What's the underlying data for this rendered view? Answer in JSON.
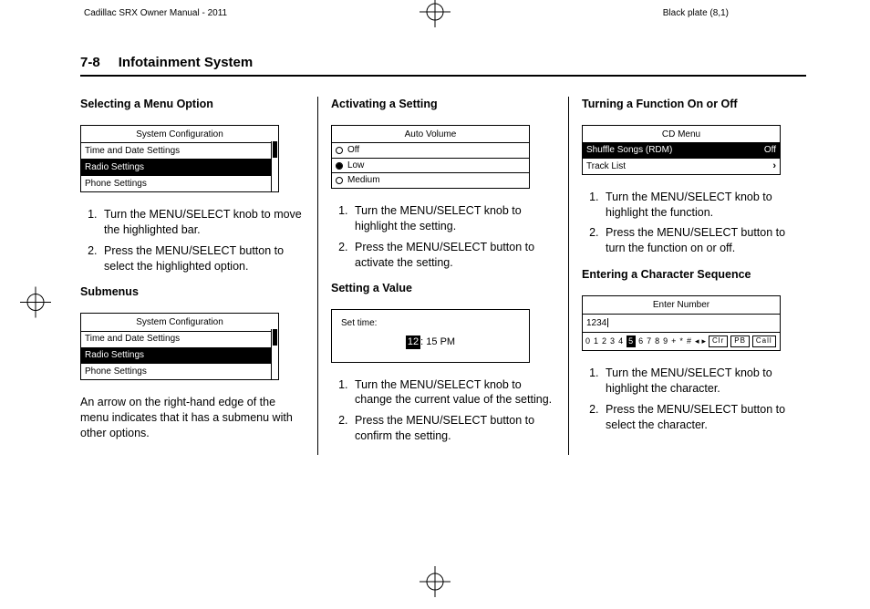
{
  "meta": {
    "doc_title": "Cadillac SRX Owner Manual - 2011",
    "plate": "Black plate (8,1)"
  },
  "header": {
    "page_ref": "7-8",
    "chapter": "Infotainment System"
  },
  "col1": {
    "h1": "Selecting a Menu Option",
    "fig1": {
      "title": "System Configuration",
      "rows": [
        "Time and Date Settings",
        "Radio Settings",
        "Phone Settings"
      ],
      "highlight_index": 1
    },
    "steps1": [
      "Turn the MENU/SELECT knob to move the highlighted bar.",
      "Press the MENU/SELECT button to select the highlighted option."
    ],
    "h2": "Submenus",
    "fig2": {
      "title": "System Configuration",
      "rows": [
        "Time and Date Settings",
        "Radio Settings",
        "Phone Settings"
      ],
      "highlight_index": 1
    },
    "p1": "An arrow on the right-hand edge of the menu indicates that it has a submenu with other options."
  },
  "col2": {
    "h1": "Activating a Setting",
    "fig1": {
      "title": "Auto Volume",
      "options": [
        "Off",
        "Low",
        "Medium"
      ],
      "selected_index": 1
    },
    "steps1": [
      "Turn the MENU/SELECT knob to highlight the setting.",
      "Press the MENU/SELECT button to activate the setting."
    ],
    "h2": "Setting a Value",
    "fig2": {
      "label": "Set time:",
      "hour": "12",
      "rest": ": 15 PM"
    },
    "steps2": [
      "Turn the MENU/SELECT knob to change the current value of the setting.",
      "Press the MENU/SELECT button to confirm the setting."
    ]
  },
  "col3": {
    "h1": "Turning a Function On or Off",
    "fig1": {
      "title": "CD Menu",
      "row1_label": "Shuffle Songs (RDM)",
      "row1_value": "Off",
      "row2_label": "Track List"
    },
    "steps1": [
      "Turn the MENU/SELECT knob to highlight the function.",
      "Press the MENU/SELECT button to turn the function on or off."
    ],
    "h2": "Entering a Character Sequence",
    "fig2": {
      "title": "Enter Number",
      "entered": "1234",
      "keys": [
        "0",
        "1",
        "2",
        "3",
        "4",
        "5",
        "6",
        "7",
        "8",
        "9",
        "+",
        "*",
        "#"
      ],
      "highlight_index": 5,
      "btn_clr": "Clr",
      "btn_pb": "PB",
      "btn_call": "Call"
    },
    "steps2": [
      "Turn the MENU/SELECT knob to highlight the character.",
      "Press the MENU/SELECT button to select the character."
    ]
  }
}
